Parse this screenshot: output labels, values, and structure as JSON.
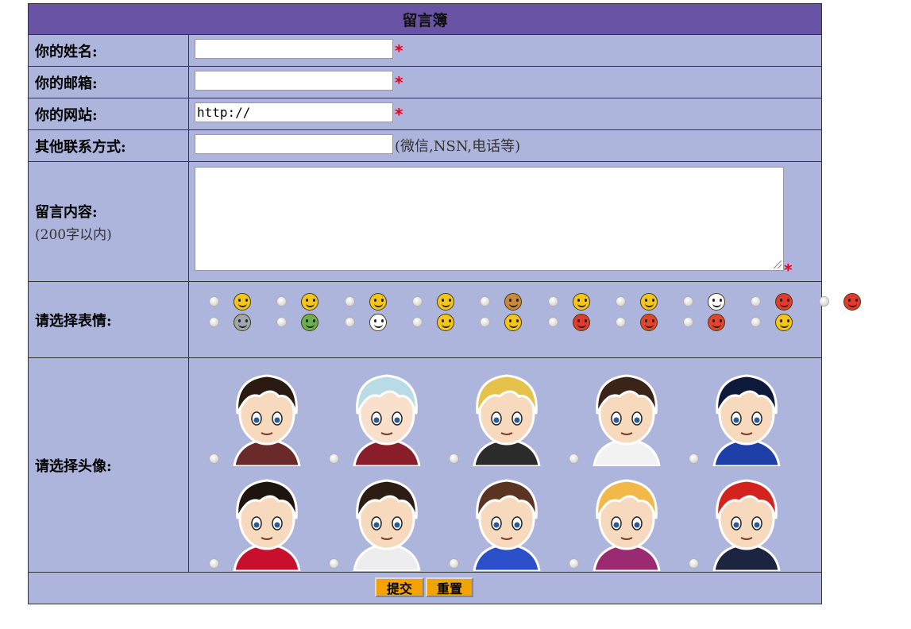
{
  "form": {
    "title": "留言簿",
    "name_label": "你的姓名:",
    "email_label": "你的邮箱:",
    "website_label": "你的网站:",
    "website_value": "http://",
    "other_label": "其他联系方式:",
    "other_hint": "(微信,NSN,电话等)",
    "content_label": "留言内容:",
    "content_hint": "(200字以内)",
    "emoticon_label": "请选择表情:",
    "avatar_label": "请选择头像:",
    "required_mark": "*",
    "submit_label": "提交",
    "reset_label": "重置"
  },
  "emoticons": [
    {
      "icon": "grin-icon",
      "color": "#f5c518"
    },
    {
      "icon": "smile-icon",
      "color": "#f5c518"
    },
    {
      "icon": "sleepy-icon",
      "color": "#f5c518"
    },
    {
      "icon": "surprised-icon",
      "color": "#f5c518"
    },
    {
      "icon": "cowboy-icon",
      "color": "#c8893a"
    },
    {
      "icon": "squint-laugh-icon",
      "color": "#f5c518"
    },
    {
      "icon": "angel-icon",
      "color": "#f5c518"
    },
    {
      "icon": "clown-icon",
      "color": "#ffffff"
    },
    {
      "icon": "goblin-icon",
      "color": "#e23b2c"
    },
    {
      "icon": "ogre-icon",
      "color": "#e23b2c"
    },
    {
      "icon": "robot-icon",
      "color": "#9fa7ad"
    },
    {
      "icon": "nauseated-icon",
      "color": "#6ab04c"
    },
    {
      "icon": "ghost-icon",
      "color": "#ffffff"
    },
    {
      "icon": "yum-icon",
      "color": "#f5c518"
    },
    {
      "icon": "thinking-icon",
      "color": "#f5c518"
    },
    {
      "icon": "cursing-icon",
      "color": "#e23b2c"
    },
    {
      "icon": "angry-icon",
      "color": "#e2452c"
    },
    {
      "icon": "devil-icon",
      "color": "#e2452c"
    },
    {
      "icon": "zipper-mouth-icon",
      "color": "#f5c518"
    }
  ],
  "avatars": [
    {
      "icon": "avatar-headband-boy-icon",
      "hair": "#2a1a12",
      "skin": "#f7d9bd",
      "shirt": "#6b2a2a"
    },
    {
      "icon": "avatar-silver-hair-girl-icon",
      "hair": "#b8dbe6",
      "skin": "#f8e0cc",
      "shirt": "#8a1d2a"
    },
    {
      "icon": "avatar-blonde-boy-icon",
      "hair": "#e6c24a",
      "skin": "#f7d9bd",
      "shirt": "#2b2b2b"
    },
    {
      "icon": "avatar-nun-girl-icon",
      "hair": "#3a2418",
      "skin": "#f7d9bd",
      "shirt": "#f2f2f2"
    },
    {
      "icon": "avatar-spiky-hair-boy-icon",
      "hair": "#0e1a3a",
      "skin": "#f7d9bd",
      "shirt": "#1f3fa8"
    },
    {
      "icon": "avatar-ponytail-girl-icon",
      "hair": "#1e140f",
      "skin": "#f7d9bd",
      "shirt": "#c8102e"
    },
    {
      "icon": "avatar-dark-hair-boy-icon",
      "hair": "#2d1c14",
      "skin": "#f7d9bd",
      "shirt": "#ededed"
    },
    {
      "icon": "avatar-brown-hair-boy-icon",
      "hair": "#5a3420",
      "skin": "#f7d9bd",
      "shirt": "#2a4fc8"
    },
    {
      "icon": "avatar-blonde-girl-icon",
      "hair": "#f2b84a",
      "skin": "#f7d9bd",
      "shirt": "#9a2a72"
    },
    {
      "icon": "avatar-red-hair-boy-icon",
      "hair": "#d4221e",
      "skin": "#f7d9bd",
      "shirt": "#1c2440"
    }
  ]
}
